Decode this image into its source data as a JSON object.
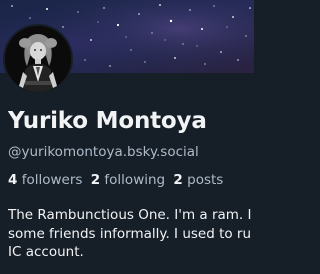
{
  "profile": {
    "display_name": "Yuriko Montoya",
    "handle": "@yurikomontoya.bsky.social",
    "stats": {
      "followers_count": "4",
      "followers_label": "followers",
      "following_count": "2",
      "following_label": "following",
      "posts_count": "2",
      "posts_label": "posts"
    },
    "bio_lines": [
      "The Rambunctious One. I'm a ram. I",
      "some friends informally. I used to ru",
      "IC account."
    ]
  },
  "colors": {
    "background": "#161e27",
    "banner": "#1b2040",
    "text_primary": "#f1f3f5",
    "text_secondary": "#aebbc9"
  }
}
